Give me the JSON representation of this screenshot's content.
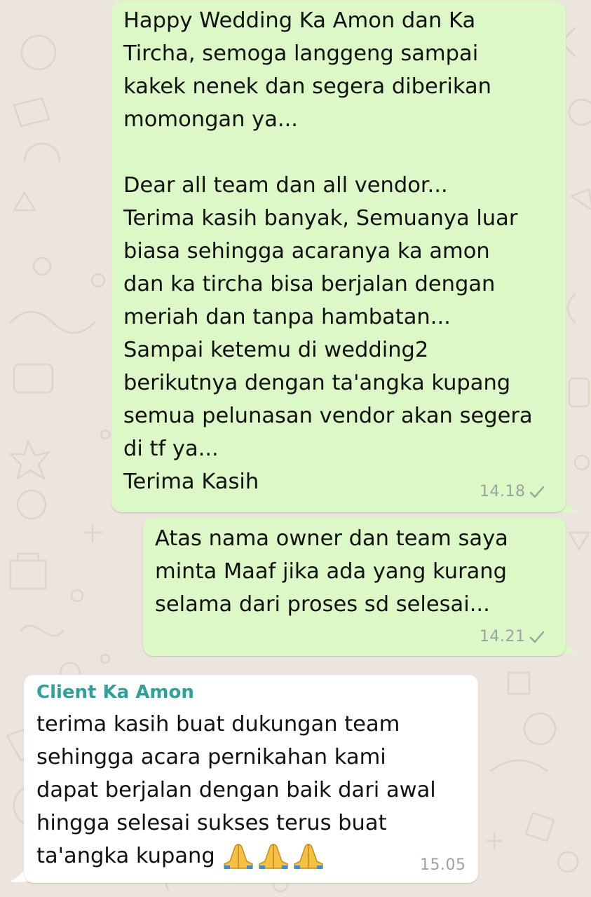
{
  "colors": {
    "wallpaper": "#ece5dd",
    "outgoing_bubble": "#dcf8c6",
    "incoming_bubble": "#ffffff",
    "sender_name": "#2fa19a",
    "timestamp": "#9aa3a0"
  },
  "messages": [
    {
      "direction": "outgoing",
      "text": "Happy Wedding Ka Amon dan Ka\nTircha, semoga langgeng sampai\nkakek  nenek dan segera diberikan\nmomongan ya...\n\nDear all team dan all vendor...\nTerima kasih banyak, Semuanya luar\nbiasa sehingga acaranya ka amon\ndan ka tircha bisa berjalan dengan\nmeriah dan tanpa hambatan...\nSampai ketemu di wedding2\nberikutnya dengan ta'angka kupang\nsemua pelunasan vendor akan segera\ndi tf ya...\nTerima Kasih",
      "time": "14.18",
      "status_icon": "single-check-icon"
    },
    {
      "direction": "outgoing",
      "text": "Atas nama owner dan team saya\nminta Maaf jika ada yang kurang\nselama dari proses sd selesai...",
      "time": "14.21",
      "status_icon": "single-check-icon"
    },
    {
      "direction": "incoming",
      "sender": "Client Ka Amon",
      "text": "terima kasih buat dukungan team\nsehingga acara pernikahan kami\ndapat berjalan dengan baik dari awal\nhingga selesai sukses terus buat\nta'angka kupang",
      "emoji": [
        "folded-hands-emoji",
        "folded-hands-emoji",
        "folded-hands-emoji"
      ],
      "time": "15.05"
    }
  ]
}
